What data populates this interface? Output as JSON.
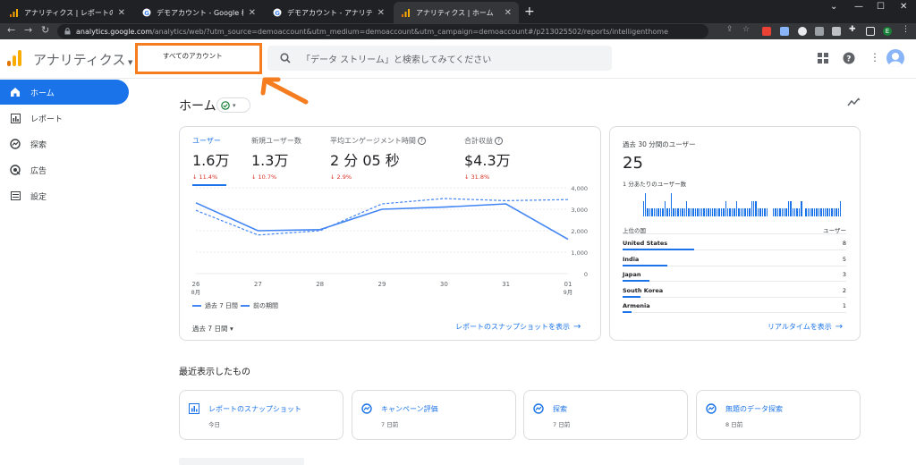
{
  "browser": {
    "tabs": [
      {
        "title": "アナリティクス | レポートのスナップショット",
        "icon": "analytics-icon",
        "active": false
      },
      {
        "title": "デモアカウント - Google 検索",
        "icon": "google-icon",
        "active": false
      },
      {
        "title": "デモアカウント - アナリティクス ヘルプ",
        "icon": "google-icon",
        "active": false
      },
      {
        "title": "アナリティクス | ホーム",
        "icon": "analytics-icon",
        "active": true
      }
    ],
    "url_host": "analytics.google.com",
    "url_path": "/analytics/web/?utm_source=demoaccount&utm_medium=demoaccount&utm_campaign=demoaccount#/p213025502/reports/intelligenthome",
    "profile_letter": "E"
  },
  "header": {
    "app_name": "アナリティクス",
    "account_label": "すべてのアカウント",
    "search_placeholder": "「データ ストリーム」と検索してみてください"
  },
  "sidebar": {
    "items": [
      {
        "label": "ホーム",
        "icon": "home-icon",
        "active": true
      },
      {
        "label": "レポート",
        "icon": "reports-icon",
        "active": false
      },
      {
        "label": "探索",
        "icon": "explore-icon",
        "active": false
      },
      {
        "label": "広告",
        "icon": "advertising-icon",
        "active": false
      },
      {
        "label": "設定",
        "icon": "settings-icon",
        "active": false
      }
    ]
  },
  "page": {
    "title": "ホーム"
  },
  "overview": {
    "metrics": [
      {
        "label": "ユーザー",
        "value": "1.6万",
        "change": "↓ 11.4%",
        "help": false,
        "selected": true
      },
      {
        "label": "新規ユーザー数",
        "value": "1.3万",
        "change": "↓ 10.7%",
        "help": false,
        "selected": false
      },
      {
        "label": "平均エンゲージメント時間",
        "value": "2 分 05 秒",
        "change": "↓ 2.9%",
        "help": true,
        "selected": false
      },
      {
        "label": "合計収益",
        "value": "$4.3万",
        "change": "↓ 31.8%",
        "help": true,
        "selected": false
      }
    ],
    "legend_current": "過去 7 日間",
    "legend_previous": "前の期間",
    "date_range": "過去 7 日間",
    "link": "レポートのスナップショットを表示"
  },
  "chart_data": {
    "type": "line",
    "x": [
      "26",
      "27",
      "28",
      "29",
      "30",
      "31",
      "01"
    ],
    "month_labels": {
      "26": "8月",
      "01": "9月"
    },
    "series": [
      {
        "name": "過去 7 日間",
        "values": [
          3300,
          2000,
          2050,
          3000,
          3100,
          3250,
          1600
        ],
        "style": "solid"
      },
      {
        "name": "前の期間",
        "values": [
          2950,
          1800,
          2000,
          3250,
          3500,
          3400,
          3450
        ],
        "style": "dashed"
      }
    ],
    "y_ticks": [
      "4,000",
      "3,000",
      "2,000",
      "1,000",
      "0"
    ],
    "ylim": [
      0,
      4000
    ],
    "grid": true,
    "color": "#4285f4"
  },
  "realtime": {
    "title": "過去 30 分間のユーザー",
    "value": "25",
    "per_minute_label": "1 分あたりのユーザー数",
    "per_minute_values": [
      0,
      0,
      0,
      0,
      0,
      0,
      2,
      3,
      1,
      1,
      1,
      1,
      1,
      1,
      1,
      1,
      2,
      1,
      1,
      3,
      1,
      1,
      1,
      1,
      1,
      1,
      2,
      1,
      1,
      1,
      1,
      1,
      1,
      1,
      1,
      1,
      1,
      1,
      1,
      1,
      1,
      1,
      1,
      1,
      2,
      1,
      1,
      1,
      1,
      2,
      1,
      1,
      1,
      1,
      1,
      1,
      2,
      2,
      2,
      1,
      1,
      1,
      1,
      1,
      0,
      0,
      1,
      1,
      1,
      1,
      1,
      1,
      1,
      2,
      2,
      1,
      1,
      1,
      1,
      2,
      0,
      1,
      1,
      1,
      1,
      1,
      1,
      1,
      1,
      1,
      1,
      1,
      1,
      1,
      1,
      1,
      1,
      2
    ],
    "col_country": "上位の国",
    "col_users": "ユーザー",
    "countries": [
      {
        "name": "United States",
        "count": "8",
        "fraction": 0.32
      },
      {
        "name": "India",
        "count": "5",
        "fraction": 0.2
      },
      {
        "name": "Japan",
        "count": "3",
        "fraction": 0.12
      },
      {
        "name": "South Korea",
        "count": "2",
        "fraction": 0.08
      },
      {
        "name": "Armenia",
        "count": "1",
        "fraction": 0.04
      }
    ],
    "link": "リアルタイムを表示"
  },
  "recent": {
    "heading": "最近表示したもの",
    "items": [
      {
        "title": "レポートのスナップショット",
        "date": "今日",
        "icon": "report-snapshot-icon"
      },
      {
        "title": "キャンペーン評価",
        "date": "7 日前",
        "icon": "explore-icon"
      },
      {
        "title": "探索",
        "date": "7 日前",
        "icon": "explore-icon"
      },
      {
        "title": "無題のデータ探索",
        "date": "8 日前",
        "icon": "explore-icon"
      }
    ]
  },
  "colors": {
    "accent": "#1a73e8",
    "highlight": "#f57c1f",
    "negative": "#d93025"
  }
}
